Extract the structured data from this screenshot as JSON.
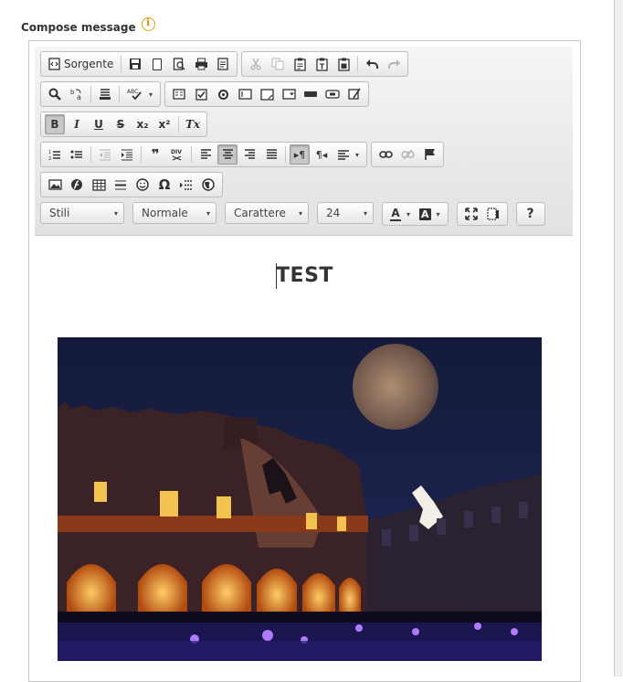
{
  "label": {
    "text": "Compose message",
    "info_glyph": "i"
  },
  "toolbar": {
    "source_label": "Sorgente",
    "combos": {
      "styles": "Stili",
      "format": "Normale",
      "font": "Carattere",
      "size": "24"
    },
    "help_glyph": "?",
    "glyphs": {
      "bold": "B",
      "italic": "I",
      "underline": "U",
      "strike": "S",
      "subscript": "x₂",
      "superscript": "x²",
      "remove_format": "Tx",
      "blockquote": "❞",
      "div": "DIV",
      "special_char": "Ω",
      "smiley": "☺",
      "text_color": "A",
      "bg_color": "A",
      "spell": "ABC",
      "ordered_list": "1≡",
      "bullet_list": "•≡",
      "ltr": "▸¶",
      "rtl": "¶◂",
      "globe": "◍",
      "flash": "⌀"
    }
  },
  "content": {
    "heading": "TEST"
  },
  "colors": {
    "toolbar_bg": "#e8e8e8",
    "active_btn": "#c9c9c9",
    "border": "#bdbdbd"
  }
}
